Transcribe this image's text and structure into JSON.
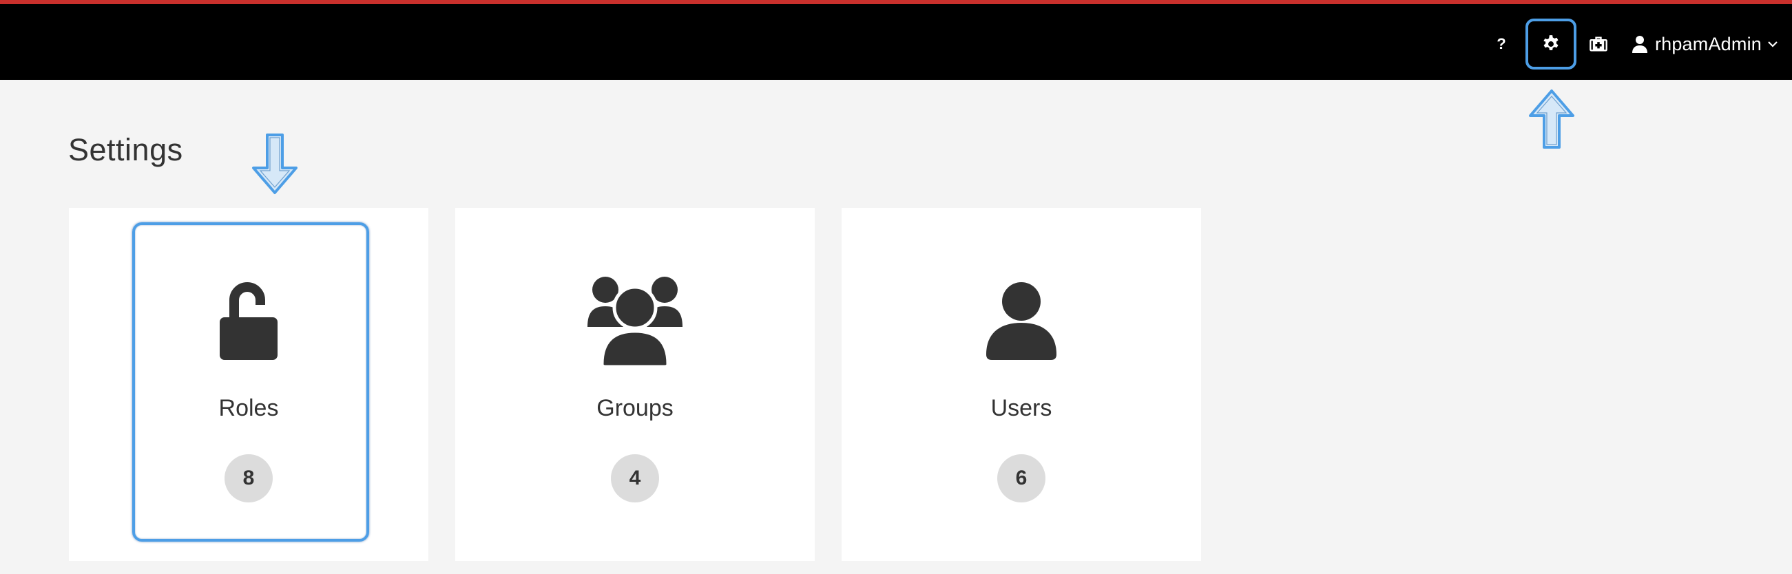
{
  "header": {
    "help_label": "?",
    "settings_icon": "gear-icon",
    "apps_icon": "briefcase-icon",
    "user_name": "rhpamAdmin",
    "accent_color": "#c9302c"
  },
  "page": {
    "title": "Settings"
  },
  "cards": [
    {
      "label": "Roles",
      "count": "8",
      "icon": "unlock-icon"
    },
    {
      "label": "Groups",
      "count": "4",
      "icon": "users-group-icon"
    },
    {
      "label": "Users",
      "count": "6",
      "icon": "user-icon"
    }
  ],
  "annotations": {
    "color": "#4d9ee6"
  }
}
